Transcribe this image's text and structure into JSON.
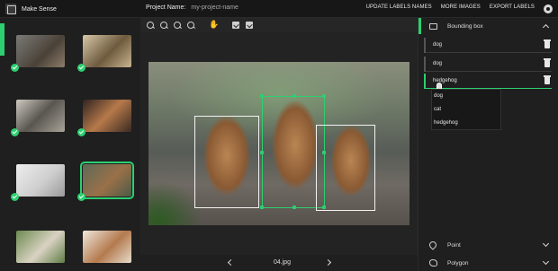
{
  "app": {
    "brand": "Make Sense"
  },
  "project": {
    "label": "Project Name:",
    "name": "my-project-name"
  },
  "top_actions": [
    "UPDATE LABELS NAMES",
    "MORE IMAGES",
    "EXPORT LABELS"
  ],
  "colors": {
    "accent": "#2dcf70",
    "background": "#1f1f1f",
    "panel": "#262626"
  },
  "icons": {
    "github": "github-icon",
    "zoom_in": "zoom-in-icon",
    "zoom_out": "zoom-out-icon",
    "zoom_fit": "zoom-fit-icon",
    "zoom_max": "zoom-max-icon",
    "hand": "hand-icon",
    "box": "box-tool-icon",
    "crosshair": "crosshair-icon"
  },
  "thumbnails": [
    {
      "checked": true,
      "selected": false
    },
    {
      "checked": true,
      "selected": false
    },
    {
      "checked": true,
      "selected": false
    },
    {
      "checked": true,
      "selected": false
    },
    {
      "checked": true,
      "selected": false
    },
    {
      "checked": true,
      "selected": true
    },
    {
      "checked": false,
      "selected": false
    },
    {
      "checked": false,
      "selected": false
    }
  ],
  "editor": {
    "filename": "04.jpg"
  },
  "sidebar": {
    "bounding_box": {
      "title": "Bounding box",
      "labels": [
        {
          "text": "dog",
          "active": false
        },
        {
          "text": "dog",
          "active": false
        },
        {
          "text": "hedgehog",
          "active": true
        }
      ],
      "dropdown_options": [
        "dog",
        "cat",
        "hedgehog"
      ]
    },
    "point": {
      "title": "Point"
    },
    "polygon": {
      "title": "Polygon"
    }
  }
}
